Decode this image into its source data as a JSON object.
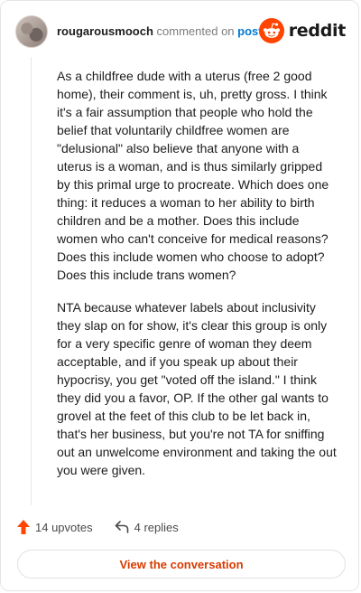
{
  "comment": {
    "username": "rougarousmooch",
    "action_text": "commented on",
    "post_link": "post",
    "paragraphs": [
      "As a childfree dude with a uterus (free 2 good home), their comment is, uh, pretty gross. I think it's a fair assumption that people who hold the belief that voluntarily childfree women are \"delusional\" also believe that anyone with a uterus is a woman, and is thus similarly gripped by this primal urge to procreate. Which does one thing: it reduces a woman to her ability to birth children and be a mother. Does this include women who can't conceive for medical reasons? Does this include women who choose to adopt? Does this include trans women?",
      "NTA because whatever labels about inclusivity they slap on for show, it's clear this group is only for a very specific genre of woman they deem acceptable, and if you speak up about their hypocrisy, you get \"voted off the island.\" I think they did you a favor, OP. If the other gal wants to grovel at the feet of this club to be let back in, that's her business, but you're not TA for sniffing out an unwelcome environment and taking the out you were given."
    ],
    "upvotes": "14 upvotes",
    "replies": "4 replies"
  },
  "brand": {
    "name": "reddit",
    "color": "#ff4500"
  },
  "cta": {
    "label": "View the conversation"
  },
  "colors": {
    "upvote": "#ff4500",
    "link": "#0079d3",
    "cta": "#d93a00"
  },
  "icons": [
    "avatar",
    "reddit-alien-icon",
    "upvote-arrow-icon",
    "reply-arrow-icon"
  ]
}
